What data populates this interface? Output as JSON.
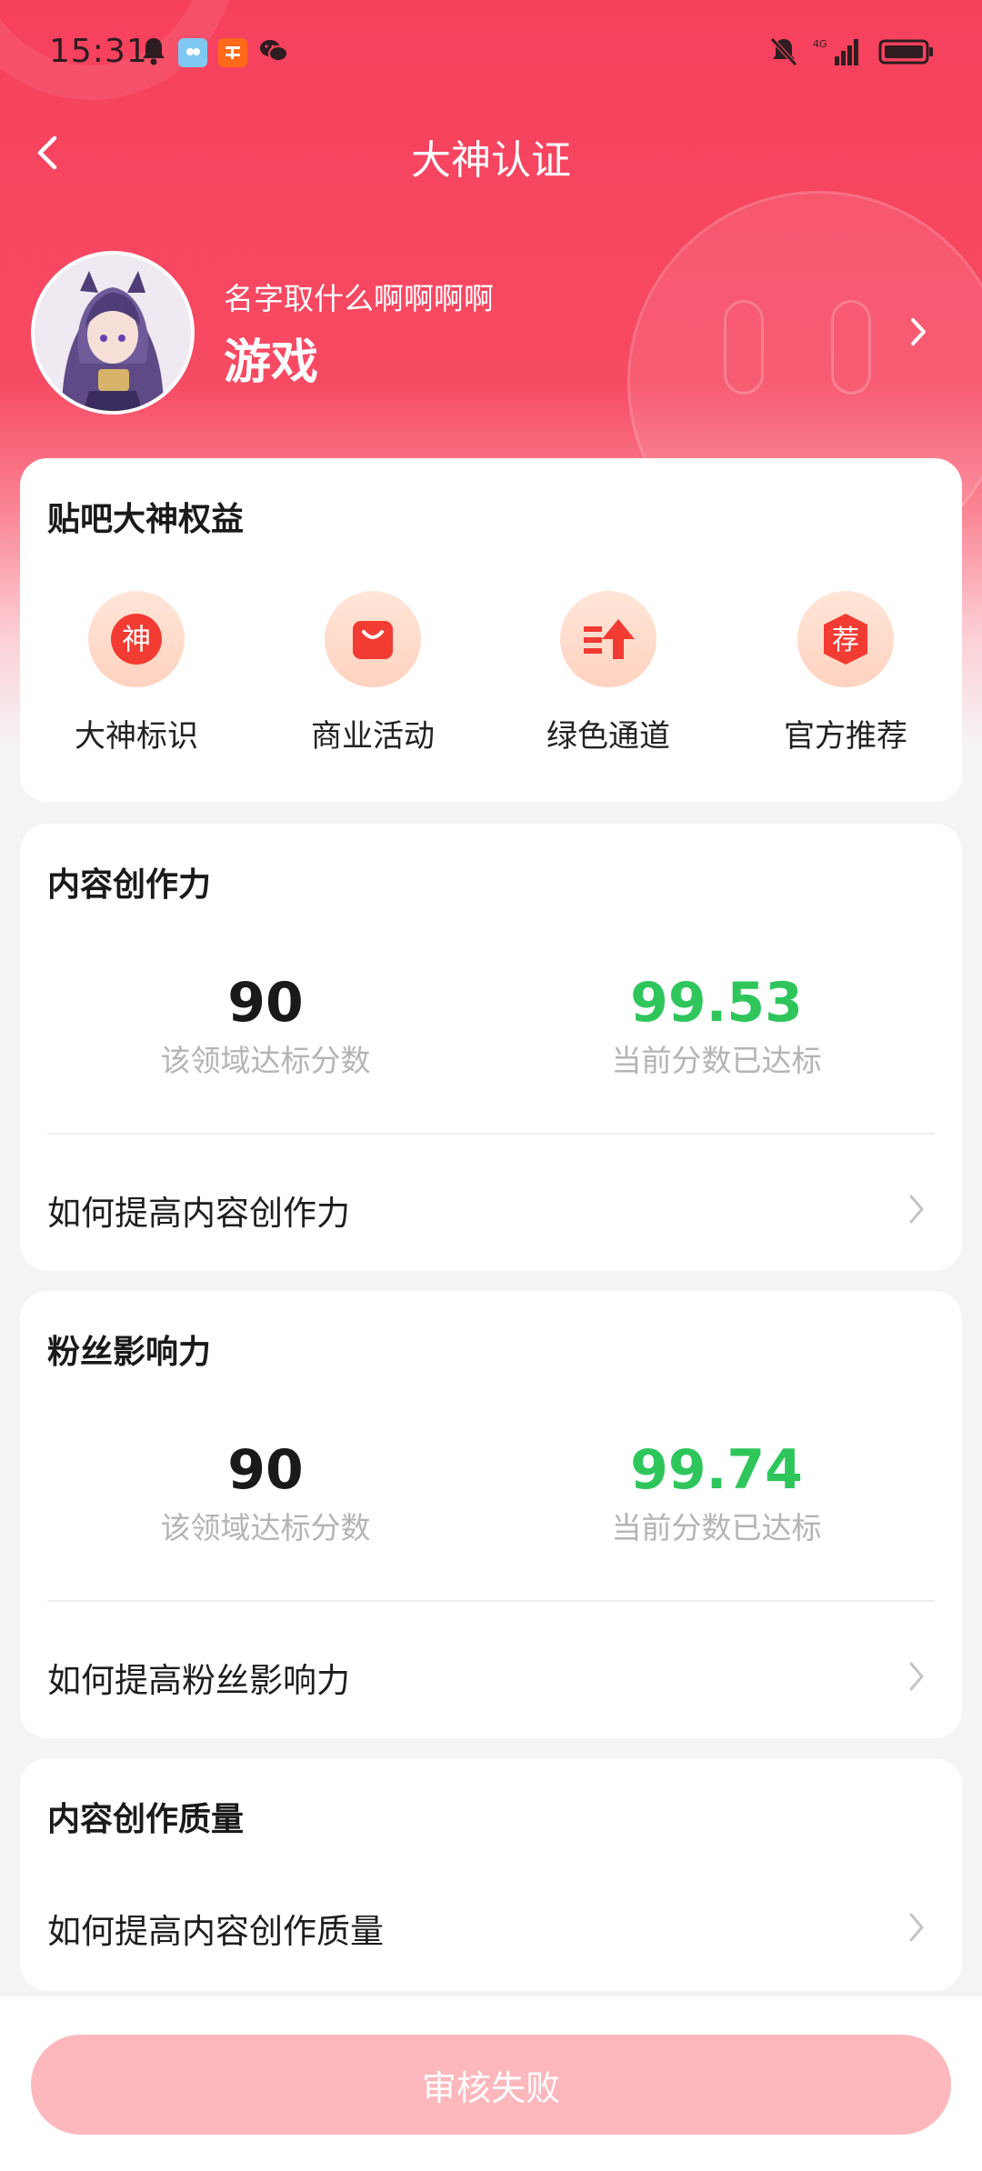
{
  "status_bar": {
    "time": "15:31"
  },
  "nav": {
    "title": "大神认证"
  },
  "profile": {
    "name": "名字取什么啊啊啊啊",
    "domain": "游戏"
  },
  "benefits": {
    "title": "贴吧大神权益",
    "items": [
      {
        "label": "大神标识",
        "icon_char": "神",
        "icon": "god-badge-icon"
      },
      {
        "label": "商业活动",
        "icon": "shopping-bag-icon"
      },
      {
        "label": "绿色通道",
        "icon": "fast-track-icon"
      },
      {
        "label": "官方推荐",
        "icon_char": "荐",
        "icon": "recommend-icon"
      }
    ]
  },
  "content_power": {
    "title": "内容创作力",
    "target": {
      "value": "90",
      "caption": "该领域达标分数"
    },
    "current": {
      "value": "99.53",
      "caption": "当前分数已达标"
    },
    "link": "如何提高内容创作力"
  },
  "fan_influence": {
    "title": "粉丝影响力",
    "target": {
      "value": "90",
      "caption": "该领域达标分数"
    },
    "current": {
      "value": "99.74",
      "caption": "当前分数已达标"
    },
    "link": "如何提高粉丝影响力"
  },
  "content_quality": {
    "title": "内容创作质量",
    "link": "如何提高内容创作质量"
  },
  "submit": {
    "label": "审核失败"
  },
  "colors": {
    "brand": "#f6415d",
    "success": "#2ec65b",
    "button_disabled": "#fdb8bd"
  }
}
